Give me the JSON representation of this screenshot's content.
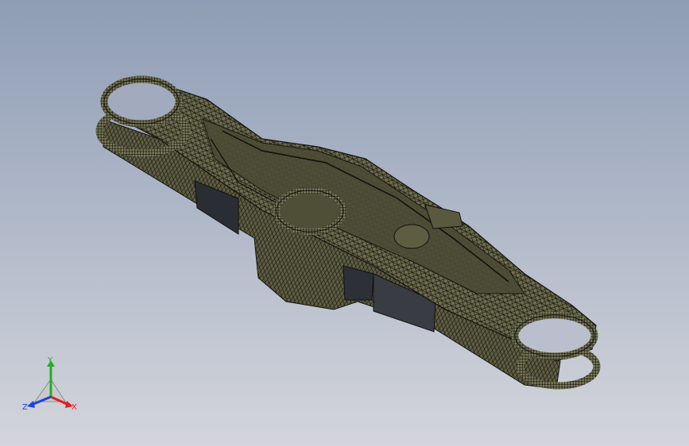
{
  "viewport": {
    "background_top": "#8e9db5",
    "background_bottom": "#d3d5db"
  },
  "model": {
    "render_mode": "shaded-with-edges",
    "mesh_color": "#6e6d4e",
    "edge_color": "#1a1a12"
  },
  "triad": {
    "x_label": "X",
    "y_label": "Y",
    "z_label": "Z",
    "x_color": "#e02020",
    "y_color": "#20b020",
    "z_color": "#2040e0"
  }
}
